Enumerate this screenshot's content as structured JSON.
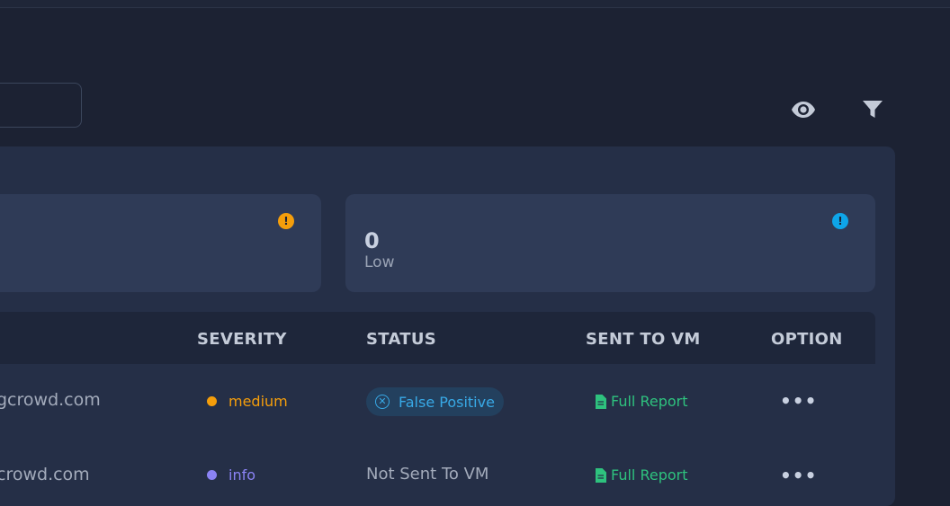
{
  "cards": [
    {
      "count": "",
      "label": "",
      "badge": "!",
      "badge_color": "#f59e0b"
    },
    {
      "count": "0",
      "label": "Low",
      "badge": "!",
      "badge_color": "#0ea5e9"
    }
  ],
  "table": {
    "headers": {
      "severity": "SEVERITY",
      "status": "STATUS",
      "sent_to_vm": "SENT TO VM",
      "option": "OPTION"
    },
    "rows": [
      {
        "host": "gcrowd.com",
        "severity": "medium",
        "severity_color": "#f59e0b",
        "status": "False Positive",
        "status_icon": "close-circle-icon",
        "sent_to_vm": "Full Report",
        "option": "•••"
      },
      {
        "host": "crowd.com",
        "severity": "info",
        "severity_color": "#8b83f5",
        "status": "Not Sent To VM",
        "sent_to_vm": "Full Report",
        "option": "•••"
      }
    ]
  },
  "icons": {
    "view": "eye-icon",
    "filter": "filter-icon",
    "report": "file-icon"
  }
}
